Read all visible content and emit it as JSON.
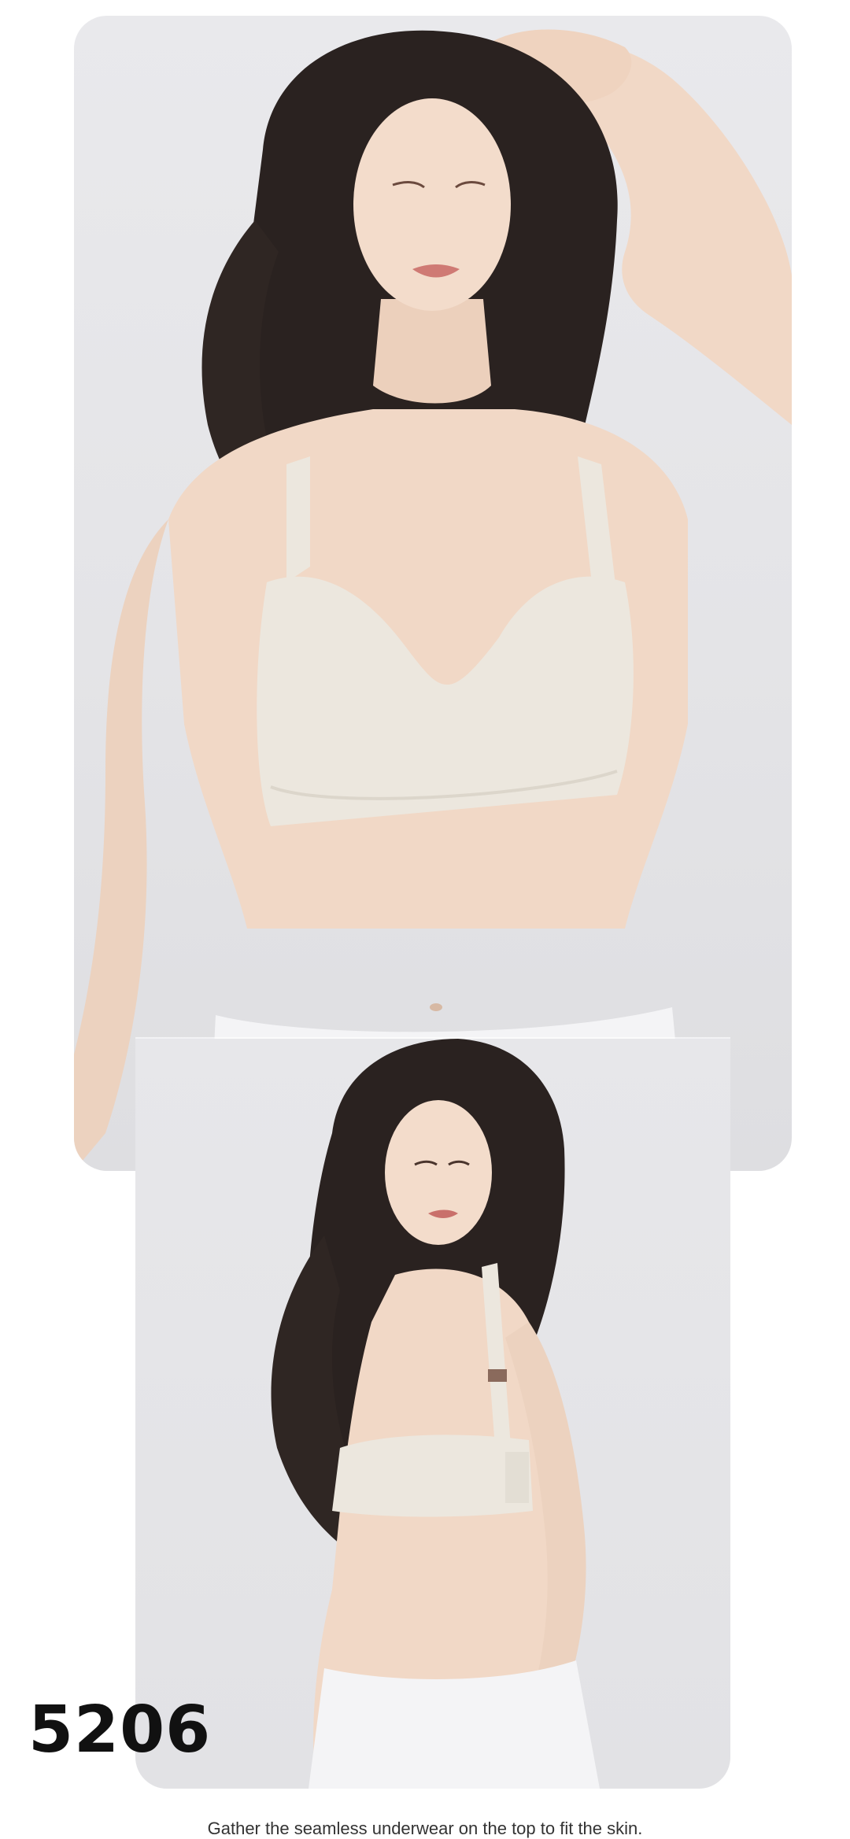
{
  "product": {
    "code": "5206",
    "caption": "Gather the seamless underwear on the top to fit the skin."
  },
  "colors": {
    "background": "#e6e6e9",
    "garment": "#ece7de",
    "skin": "#f1d8c6",
    "hair": "#2a2220",
    "pants": "#f4f4f6"
  },
  "images": {
    "top": "model-front-photo",
    "bottom": "model-back-photo"
  }
}
